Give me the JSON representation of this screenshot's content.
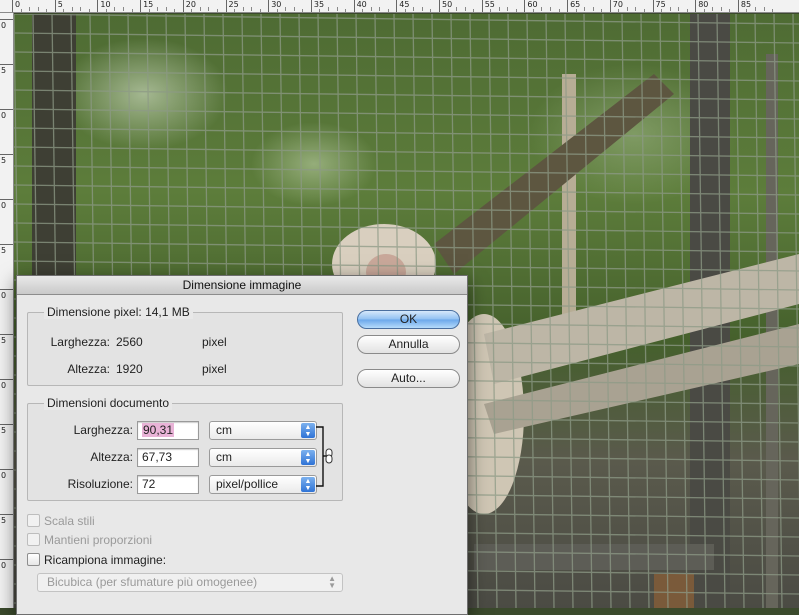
{
  "ruler_top_labels": [
    "0",
    "5",
    "10",
    "15",
    "20",
    "25",
    "30",
    "35",
    "40",
    "45",
    "50",
    "55",
    "60",
    "65",
    "70",
    "75",
    "80",
    "85"
  ],
  "ruler_left_labels": [
    "0",
    "5",
    "0",
    "5",
    "0",
    "5",
    "0",
    "5",
    "0",
    "5",
    "0",
    "5",
    "0"
  ],
  "dialog": {
    "title": "Dimensione immagine",
    "pixel_group": {
      "legend_label": "Dimensione pixel:",
      "legend_value": "14,1 MB",
      "width_label": "Larghezza:",
      "width_value": "2560",
      "width_unit": "pixel",
      "height_label": "Altezza:",
      "height_value": "1920",
      "height_unit": "pixel"
    },
    "doc_group": {
      "legend": "Dimensioni documento",
      "width_label": "Larghezza:",
      "width_value": "90,31",
      "width_unit": "cm",
      "height_label": "Altezza:",
      "height_value": "67,73",
      "height_unit": "cm",
      "resolution_label": "Risoluzione:",
      "resolution_value": "72",
      "resolution_unit": "pixel/pollice"
    },
    "buttons": {
      "ok": "OK",
      "cancel": "Annulla",
      "auto": "Auto..."
    },
    "checkboxes": {
      "scale_styles": "Scala stili",
      "constrain": "Mantieni proporzioni",
      "resample": "Ricampiona immagine:"
    },
    "resample_method": "Bicubica (per sfumature più omogenee)",
    "link_icon": "chain-link-icon",
    "popup_icon": "up-down-arrows-icon"
  }
}
